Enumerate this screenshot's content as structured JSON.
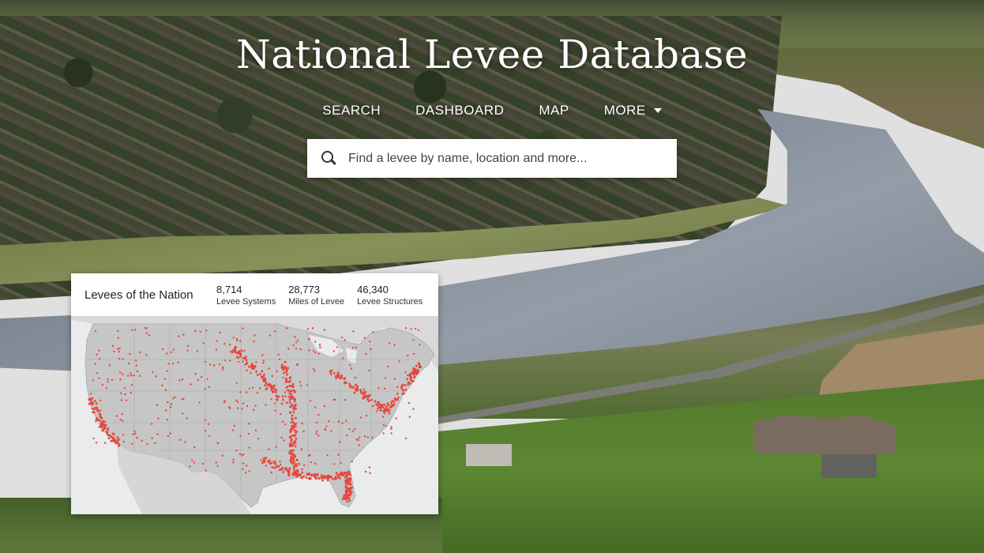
{
  "header": {
    "title": "National Levee Database",
    "nav": [
      {
        "label": "SEARCH"
      },
      {
        "label": "DASHBOARD"
      },
      {
        "label": "MAP"
      },
      {
        "label": "MORE"
      }
    ]
  },
  "search": {
    "placeholder": "Find a levee by name, location and more...",
    "icon": "search-icon"
  },
  "card": {
    "title": "Levees of the Nation",
    "stats": [
      {
        "value": "8,714",
        "label": "Levee Systems"
      },
      {
        "value": "28,773",
        "label": "Miles of Levee"
      },
      {
        "value": "46,340",
        "label": "Levee Structures"
      }
    ]
  },
  "colors": {
    "levee_marker": "#e8453c",
    "land": "#c9c9c9",
    "water": "#e9ebed"
  }
}
